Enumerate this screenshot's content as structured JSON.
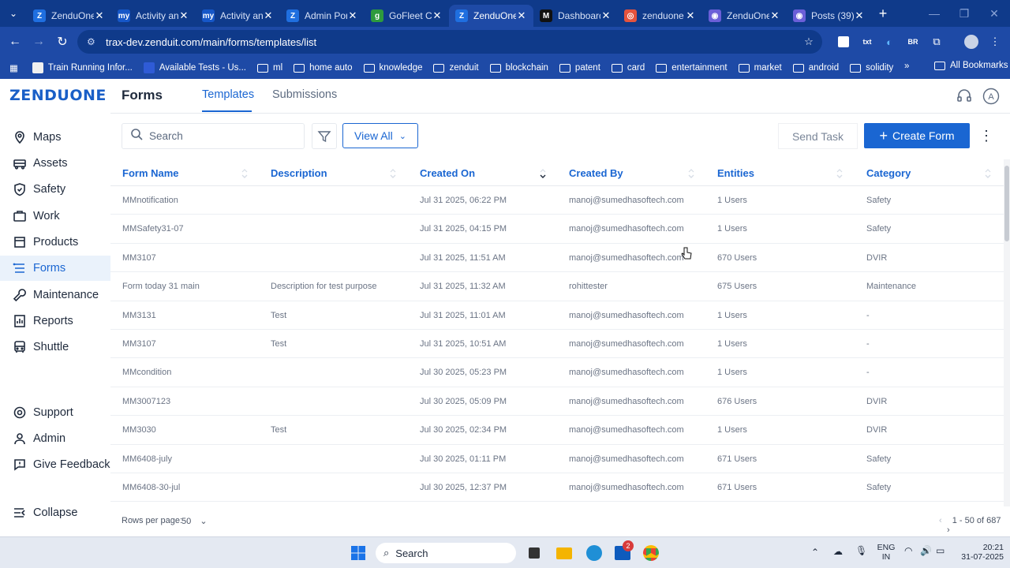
{
  "browser": {
    "tabs": [
      {
        "title": "ZenduOne",
        "fav": "Z",
        "color": "#1f6fe0",
        "active": false
      },
      {
        "title": "Activity an",
        "fav": "my",
        "color": "#1657c8",
        "active": false
      },
      {
        "title": "Activity an",
        "fav": "my",
        "color": "#1657c8",
        "active": false
      },
      {
        "title": "Admin Por",
        "fav": "Z",
        "color": "#1f6fe0",
        "active": false
      },
      {
        "title": "GoFleet C",
        "fav": "g",
        "color": "#2e9a3d",
        "active": false
      },
      {
        "title": "ZenduOne",
        "fav": "Z",
        "color": "#1f6fe0",
        "active": true
      },
      {
        "title": "Dashboard",
        "fav": "M",
        "color": "#111111",
        "active": false
      },
      {
        "title": "zenduone",
        "fav": "◎",
        "color": "#e5533d",
        "active": false
      },
      {
        "title": "ZenduOne",
        "fav": "◉",
        "color": "#6b5fd8",
        "active": false
      },
      {
        "title": "Posts (39)",
        "fav": "◉",
        "color": "#6b5fd8",
        "active": false
      }
    ],
    "url": "trax-dev.zenduit.com/main/forms/templates/list",
    "bookmarks": [
      {
        "label": "Train Running Infor...",
        "type": "icon",
        "color": "#f0f0f0"
      },
      {
        "label": "Available Tests - Us...",
        "type": "icon",
        "color": "#2f5bd6"
      },
      {
        "label": "ml",
        "type": "folder"
      },
      {
        "label": "home auto",
        "type": "folder"
      },
      {
        "label": "knowledge",
        "type": "folder"
      },
      {
        "label": "zenduit",
        "type": "folder"
      },
      {
        "label": "blockchain",
        "type": "folder"
      },
      {
        "label": "patent",
        "type": "folder"
      },
      {
        "label": "card",
        "type": "folder"
      },
      {
        "label": "entertainment",
        "type": "folder"
      },
      {
        "label": "market",
        "type": "folder"
      },
      {
        "label": "android",
        "type": "folder"
      },
      {
        "label": "solidity",
        "type": "folder"
      }
    ],
    "all_bookmarks": "All Bookmarks"
  },
  "app": {
    "logo": "ZENDUONE",
    "page_title": "Forms",
    "tabs": [
      "Templates",
      "Submissions"
    ],
    "sidebar": [
      {
        "label": "Maps",
        "icon": "map-pin-icon"
      },
      {
        "label": "Assets",
        "icon": "truck-icon"
      },
      {
        "label": "Safety",
        "icon": "shield-icon"
      },
      {
        "label": "Work",
        "icon": "briefcase-icon"
      },
      {
        "label": "Products",
        "icon": "box-icon"
      },
      {
        "label": "Forms",
        "icon": "forms-icon",
        "active": true
      },
      {
        "label": "Maintenance",
        "icon": "wrench-icon"
      },
      {
        "label": "Reports",
        "icon": "reports-icon"
      },
      {
        "label": "Shuttle",
        "icon": "bus-icon"
      }
    ],
    "sidebar_bottom": [
      {
        "label": "Support",
        "icon": "support-icon"
      },
      {
        "label": "Admin",
        "icon": "admin-icon"
      },
      {
        "label": "Give Feedback",
        "icon": "feedback-icon"
      }
    ],
    "collapse": "Collapse",
    "search_placeholder": "Search",
    "view_all": "View All",
    "send_task": "Send Task",
    "create_form": "Create Form",
    "columns": [
      "Form Name",
      "Description",
      "Created On",
      "Created By",
      "Entities",
      "Category"
    ],
    "rows": [
      [
        "MMnotification",
        "",
        "Jul 31 2025, 06:22 PM",
        "manoj@sumedhasoftech.com",
        "1 Users",
        "Safety"
      ],
      [
        "MMSafety31-07",
        "",
        "Jul 31 2025, 04:15 PM",
        "manoj@sumedhasoftech.com",
        "1 Users",
        "Safety"
      ],
      [
        "MM3107",
        "",
        "Jul 31 2025, 11:51 AM",
        "manoj@sumedhasoftech.com",
        "670 Users",
        "DVIR"
      ],
      [
        "Form today 31 main",
        "Description for test purpose",
        "Jul 31 2025, 11:32 AM",
        "rohittester",
        "675 Users",
        "Maintenance"
      ],
      [
        "MM3131",
        "Test",
        "Jul 31 2025, 11:01 AM",
        "manoj@sumedhasoftech.com",
        "1 Users",
        "-"
      ],
      [
        "MM3107",
        "Test",
        "Jul 31 2025, 10:51 AM",
        "manoj@sumedhasoftech.com",
        "1 Users",
        "-"
      ],
      [
        "MMcondition",
        "",
        "Jul 30 2025, 05:23 PM",
        "manoj@sumedhasoftech.com",
        "1 Users",
        "-"
      ],
      [
        "MM3007123",
        "",
        "Jul 30 2025, 05:09 PM",
        "manoj@sumedhasoftech.com",
        "676 Users",
        "DVIR"
      ],
      [
        "MM3030",
        "Test",
        "Jul 30 2025, 02:34 PM",
        "manoj@sumedhasoftech.com",
        "1 Users",
        "DVIR"
      ],
      [
        "MM6408-july",
        "",
        "Jul 30 2025, 01:11 PM",
        "manoj@sumedhasoftech.com",
        "671 Users",
        "Safety"
      ],
      [
        "MM6408-30-jul",
        "",
        "Jul 30 2025, 12:37 PM",
        "manoj@sumedhasoftech.com",
        "671 Users",
        "Safety"
      ]
    ],
    "rows_per_page_label": "Rows per page:",
    "rows_per_page": "50",
    "pagination": "1 - 50 of 687"
  },
  "taskbar": {
    "search": "Search",
    "lang": "ENG",
    "region": "IN",
    "time": "20:21",
    "date": "31-07-2025",
    "chrome_badge": "2"
  }
}
